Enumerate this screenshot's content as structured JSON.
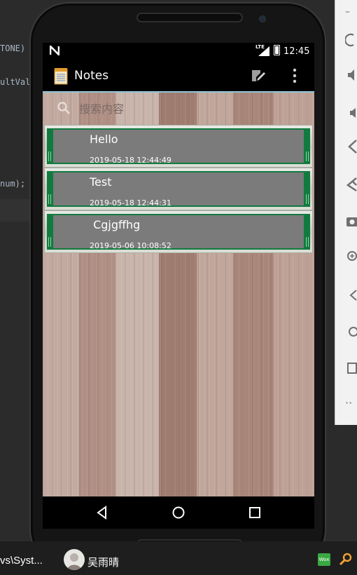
{
  "ide": {
    "lines": [
      "TONE)",
      "ultVal",
      "num);"
    ]
  },
  "emulator_toolbar": {
    "items": [
      "power-icon",
      "volume-up-icon",
      "volume-down-icon",
      "rotate-left-icon",
      "rotate-right-icon",
      "camera-icon",
      "zoom-icon",
      "back-icon",
      "home-icon",
      "overview-icon",
      "more-icon"
    ]
  },
  "status_bar": {
    "network": "LTE",
    "time": "12:45"
  },
  "app_bar": {
    "title": "Notes"
  },
  "search": {
    "placeholder": "搜索内容",
    "value": ""
  },
  "notes": [
    {
      "title": "Hello",
      "date": "2019-05-18 12:44:49"
    },
    {
      "title": "Test",
      "date": "2019-05-18 12:44:31"
    },
    {
      "title": " Cgjgffhg",
      "date": "2019-05-06 10:08:52"
    }
  ],
  "taskbar": {
    "window_label": "vs\\Syst...",
    "user_name": "吴雨晴",
    "wox_label": "Wox"
  },
  "colors": {
    "note_border": "#117a3e",
    "note_fill": "#7b7b7b",
    "accent_line": "#8fc5d8"
  }
}
